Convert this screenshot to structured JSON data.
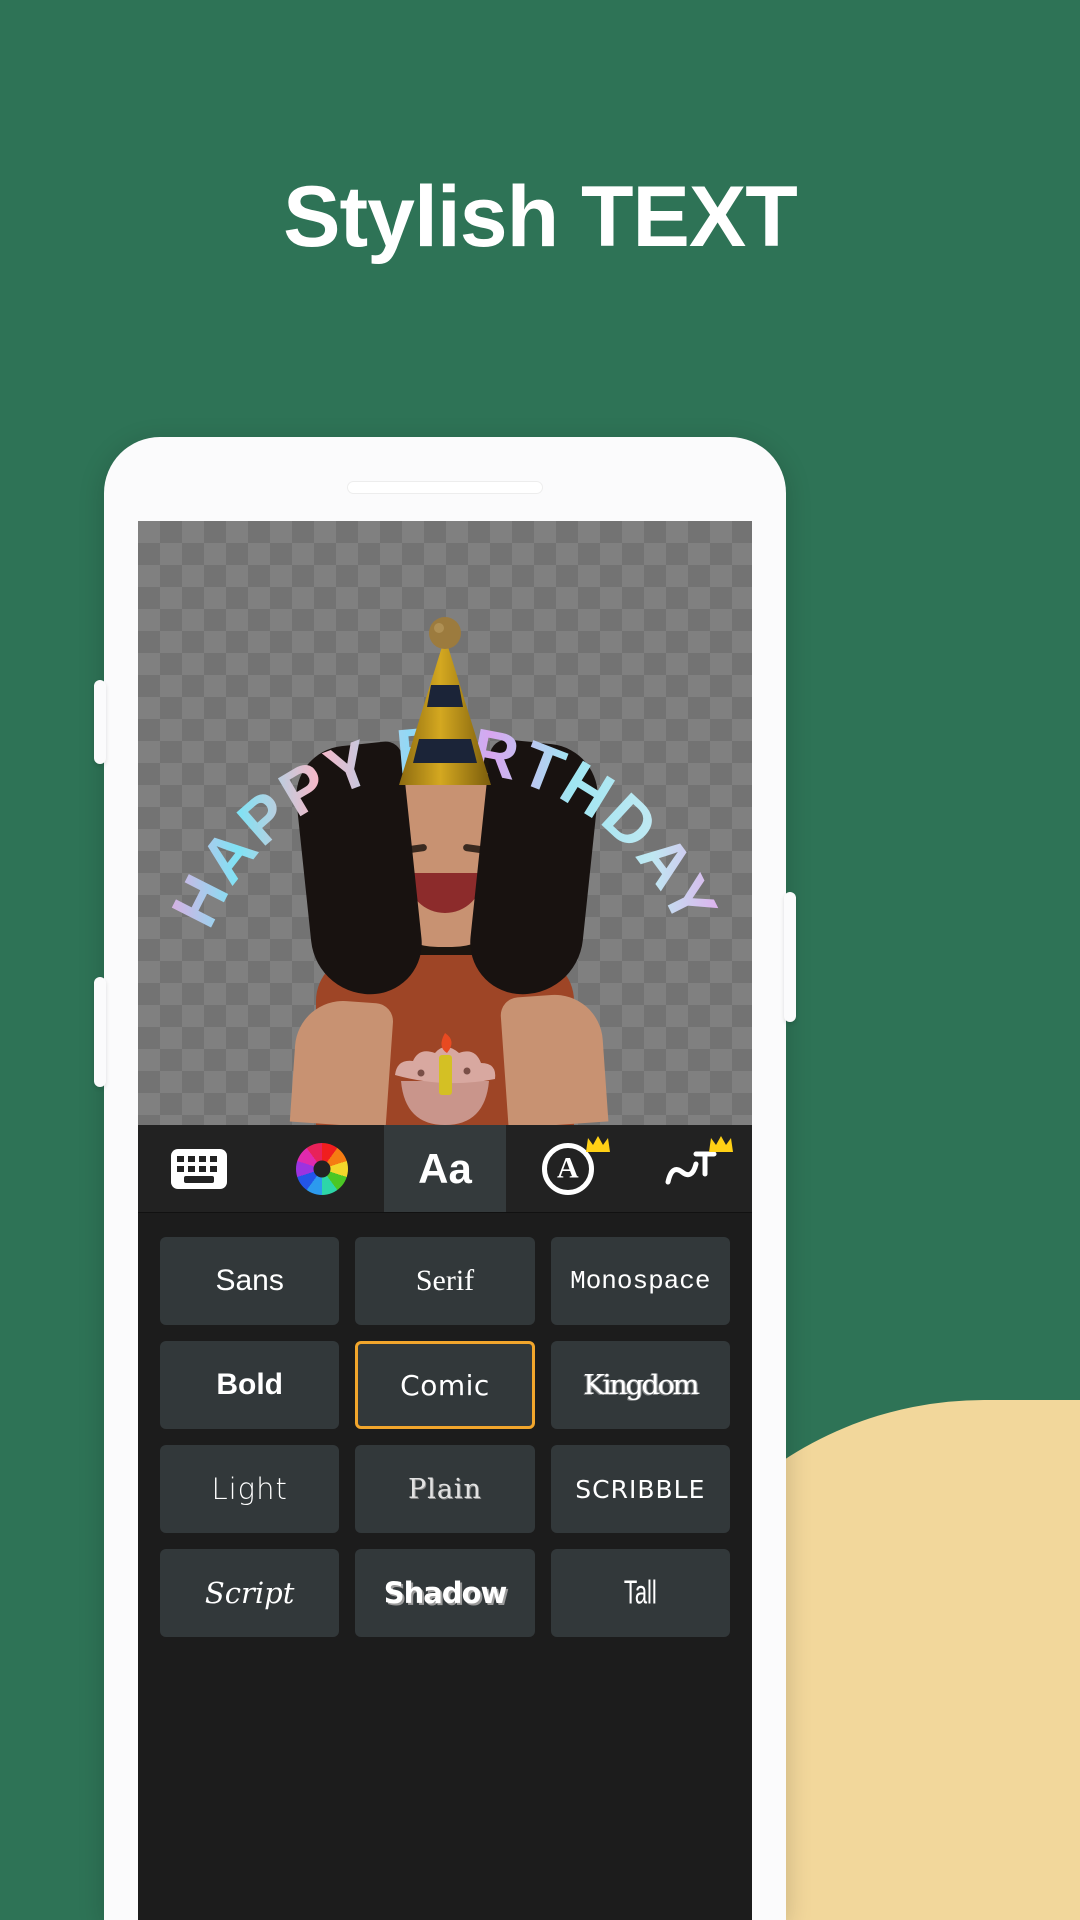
{
  "headline": "Stylish TEXT",
  "theme": {
    "background": "#2E7356",
    "accent_sand": "#F2D79B",
    "selection_border": "#F2A62C",
    "screen_bg": "#1C1C1C",
    "toolbar_bg": "#222222",
    "tile_bg": "#32383A",
    "crown_color": "#FFD015"
  },
  "canvas": {
    "arc_text": "HAPPY BIRTHDAY",
    "background": "transparent-checkerboard",
    "sticker_cupcake": "cupcake-sticker",
    "sticker_hat": "party-hat-sticker"
  },
  "toolbar": {
    "items": [
      {
        "icon": "keyboard-icon",
        "label": "Keyboard",
        "active": false,
        "pro": false
      },
      {
        "icon": "color-wheel-icon",
        "label": "Color",
        "active": false,
        "pro": false
      },
      {
        "icon": "font-aa-icon",
        "label": "Aa",
        "active": true,
        "pro": false
      },
      {
        "icon": "outline-a-icon",
        "label": "Outline",
        "active": false,
        "pro": true
      },
      {
        "icon": "curve-text-icon",
        "label": "Curve",
        "active": false,
        "pro": true
      }
    ]
  },
  "font_grid": {
    "selected": "Comic",
    "items": [
      {
        "label": "Sans",
        "style": "f-sans"
      },
      {
        "label": "Serif",
        "style": "f-serif"
      },
      {
        "label": "Monospace",
        "style": "f-mono"
      },
      {
        "label": "Bold",
        "style": "f-bold"
      },
      {
        "label": "Comic",
        "style": "f-comic"
      },
      {
        "label": "Kingdom",
        "style": "f-kingdom"
      },
      {
        "label": "Light",
        "style": "f-light"
      },
      {
        "label": "Plain",
        "style": "f-plain"
      },
      {
        "label": "SCRIBBLE",
        "style": "f-scribble"
      },
      {
        "label": "Script",
        "style": "f-script"
      },
      {
        "label": "Shadow",
        "style": "f-shadow"
      },
      {
        "label": "Tall",
        "style": "f-tall"
      }
    ]
  }
}
